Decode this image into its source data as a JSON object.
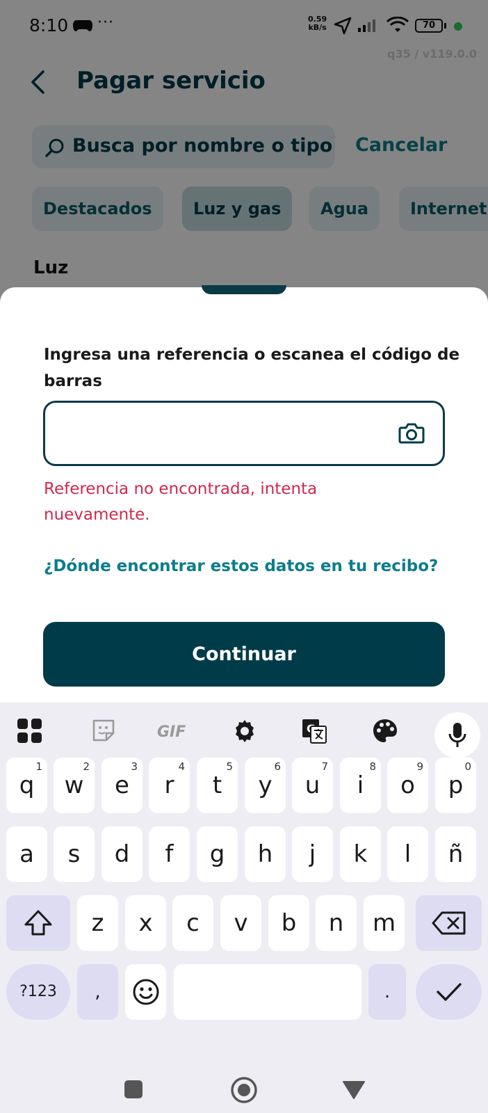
{
  "status_bar": {
    "time": "8:10",
    "dots": "···",
    "speed_value": "0.59",
    "speed_unit": "kB/s",
    "battery": "70",
    "version": "q35 / v119.0.0"
  },
  "header": {
    "title": "Pagar servicio"
  },
  "search": {
    "placeholder": "Busca por nombre o tipo de servicio",
    "visible_text": "Busca por nombre o tipo d",
    "cancel_label": "Cancelar"
  },
  "categories": [
    "Destacados",
    "Luz y gas",
    "Agua",
    "Internet,"
  ],
  "section_title": "Luz",
  "sheet": {
    "label": "Ingresa una referencia o escanea el código de barras",
    "input_value": "",
    "error": "Referencia no encontrada, intenta nuevamente.",
    "help_link": "¿Dónde encontrar estos datos en tu recibo?",
    "continue_label": "Continuar"
  },
  "keyboard": {
    "toolbar": [
      "apps-grid-icon",
      "sticker-icon",
      "gif-icon",
      "settings-gear-icon",
      "translate-icon",
      "palette-icon",
      "mic-icon"
    ],
    "gif_label": "GIF",
    "row1": [
      {
        "k": "q",
        "n": "1"
      },
      {
        "k": "w",
        "n": "2"
      },
      {
        "k": "e",
        "n": "3"
      },
      {
        "k": "r",
        "n": "4"
      },
      {
        "k": "t",
        "n": "5"
      },
      {
        "k": "y",
        "n": "6"
      },
      {
        "k": "u",
        "n": "7"
      },
      {
        "k": "i",
        "n": "8"
      },
      {
        "k": "o",
        "n": "9"
      },
      {
        "k": "p",
        "n": "0"
      }
    ],
    "row2": [
      "a",
      "s",
      "d",
      "f",
      "g",
      "h",
      "j",
      "k",
      "l",
      "ñ"
    ],
    "row3": [
      "z",
      "x",
      "c",
      "v",
      "b",
      "n",
      "m"
    ],
    "symbols_label": "?123",
    "comma": ",",
    "period": "."
  },
  "colors": {
    "brand_dark": "#003b4a",
    "accent_teal": "#0d7d8b",
    "error": "#d0284e",
    "keyboard_fn": "#dedcf3"
  }
}
